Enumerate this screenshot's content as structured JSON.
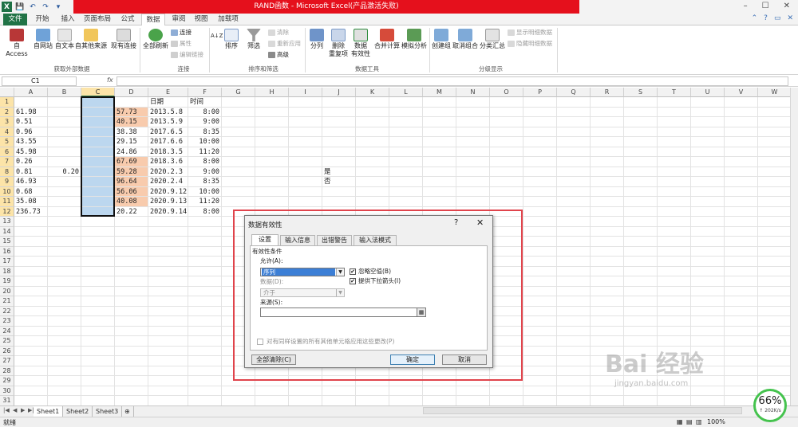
{
  "window": {
    "title": "RAND函数 - Microsoft Excel(产品激活失败)",
    "logo_letter": "X"
  },
  "qat": {
    "save_glyph": "💾",
    "undo_glyph": "↶",
    "redo_glyph": "↷",
    "custom_glyph": "▾"
  },
  "tabs": [
    {
      "label": "文件"
    },
    {
      "label": "开始"
    },
    {
      "label": "插入"
    },
    {
      "label": "页面布局"
    },
    {
      "label": "公式"
    },
    {
      "label": "数据"
    },
    {
      "label": "审阅"
    },
    {
      "label": "视图"
    },
    {
      "label": "加载项"
    }
  ],
  "ribbon": {
    "external": {
      "access": "自 Access",
      "web": "自网站",
      "text": "自文本",
      "other": "自其他来源",
      "existing": "现有连接",
      "group": "获取外部数据"
    },
    "connections": {
      "refresh_all": "全部刷新",
      "connections": "连接",
      "properties": "属性",
      "edit_links": "编辑链接",
      "group": "连接"
    },
    "sort_filter": {
      "sort_az": "A↓Z",
      "sort": "排序",
      "filter": "筛选",
      "clear": "清除",
      "reapply": "重新应用",
      "advanced": "高级",
      "group": "排序和筛选"
    },
    "data_tools": {
      "split": "分列",
      "remove_dup_1": "删除",
      "remove_dup_2": "重复项",
      "validation_1": "数据",
      "validation_2": "有效性",
      "consolidate": "合并计算",
      "whatif": "模拟分析",
      "group": "数据工具"
    },
    "outline": {
      "group_btn": "创建组",
      "ungroup": "取消组合",
      "subtotal": "分类汇总",
      "show_detail": "显示明细数据",
      "hide_detail": "隐藏明细数据",
      "group": "分级显示"
    }
  },
  "formula_bar": {
    "name_box": "C1",
    "fx": "fx",
    "value": ""
  },
  "grid": {
    "columns": [
      "A",
      "B",
      "C",
      "D",
      "E",
      "F",
      "G",
      "H",
      "I",
      "J",
      "K",
      "L",
      "M",
      "N",
      "O",
      "P",
      "Q",
      "R",
      "S",
      "T",
      "U",
      "V",
      "W"
    ],
    "rows": [
      "1",
      "2",
      "3",
      "4",
      "5",
      "6",
      "7",
      "8",
      "9",
      "10",
      "11",
      "12",
      "13",
      "14",
      "15",
      "16",
      "17",
      "18",
      "19",
      "20",
      "21",
      "22",
      "23",
      "24",
      "25",
      "26",
      "27",
      "28",
      "29",
      "30",
      "31"
    ],
    "colA": [
      "",
      "61.98",
      "0.51",
      "0.96",
      "43.55",
      "45.98",
      "0.26",
      "0.81",
      "46.93",
      "0.68",
      "35.08",
      "236.73"
    ],
    "colB_row8": "0.20",
    "colD": [
      "",
      "57.73",
      "40.15",
      "38.38",
      "29.15",
      "24.86",
      "67.69",
      "59.28",
      "96.64",
      "56.06",
      "40.08",
      "20.22"
    ],
    "colE": [
      "日期",
      "2013.5.8",
      "2013.5.9",
      "2017.6.5",
      "2017.6.6",
      "2018.3.5",
      "2018.3.6",
      "2020.2.3",
      "2020.2.4",
      "2020.9.12",
      "2020.9.13",
      "2020.9.14"
    ],
    "colF": [
      "时间",
      "8:00",
      "9:00",
      "8:35",
      "10:00",
      "11:20",
      "8:00",
      "9:00",
      "8:35",
      "10:00",
      "11:20",
      "8:00"
    ],
    "colJ_row8": "是",
    "colJ_row9": "否"
  },
  "sheets": {
    "tabs": [
      "Sheet1",
      "Sheet2",
      "Sheet3"
    ],
    "active": "Sheet1"
  },
  "status": {
    "ready": "就绪",
    "zoom": "100%"
  },
  "dialog": {
    "title": "数据有效性",
    "help": "?",
    "close": "✕",
    "tabs": [
      "设置",
      "输入信息",
      "出错警告",
      "输入法模式"
    ],
    "criteria_label": "有效性条件",
    "allow_label": "允许(A):",
    "allow_value": "序列",
    "data_label": "数据(D):",
    "data_value": "介于",
    "ignore_blank": "忽略空值(B)",
    "dropdown": "提供下拉箭头(I)",
    "source_label": "来源(S):",
    "source_value": "",
    "apply_all": "对有同样设置的所有其他单元格应用这些更改(P)",
    "clear_all": "全部清除(C)",
    "ok": "确定",
    "cancel": "取消",
    "check_mark": "✔"
  },
  "watermark": {
    "text": "Bai 经验",
    "url": "jingyan.baidu.com"
  },
  "speed": {
    "percent": "66%",
    "rate": "↑ 202K/s"
  },
  "colors": {
    "excel_green": "#217346",
    "title_red": "#e5101c",
    "selection": "#bcd7ef",
    "highlight": "#f8cbad",
    "frame_red": "#e0444c"
  }
}
